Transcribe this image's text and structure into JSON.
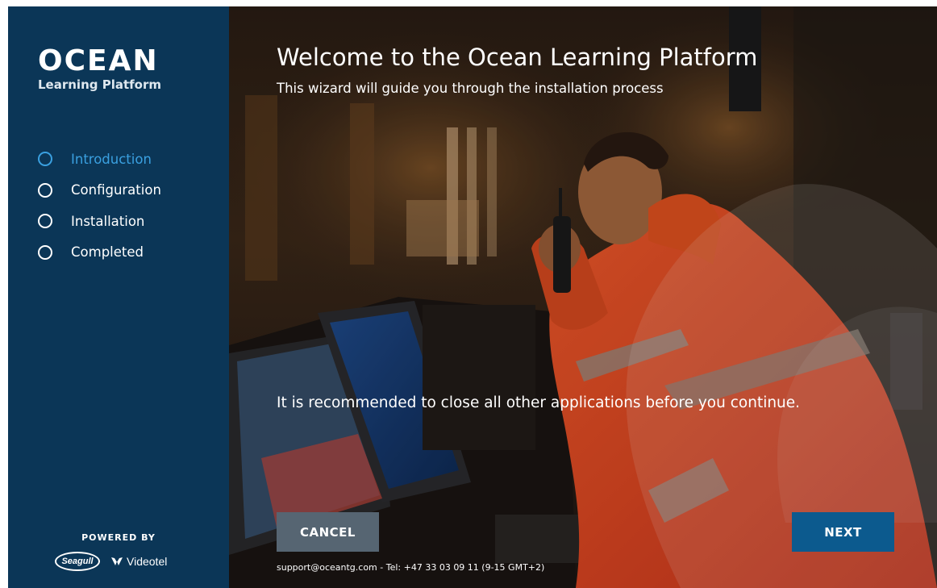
{
  "app": {
    "logo_main": "OCEAN",
    "logo_sub": "Learning Platform"
  },
  "sidebar": {
    "steps": [
      {
        "label": "Introduction",
        "active": true
      },
      {
        "label": "Configuration",
        "active": false
      },
      {
        "label": "Installation",
        "active": false
      },
      {
        "label": "Completed",
        "active": false
      }
    ],
    "powered_by": "POWERED BY",
    "partner_1": "Seagull",
    "partner_2": "Videotel"
  },
  "main": {
    "title": "Welcome to the Ocean Learning Platform",
    "subtitle": "This wizard will guide you through the installation process",
    "notice": "It is recommended to close all other applications before you continue.",
    "cancel_label": "CANCEL",
    "next_label": "NEXT",
    "support": "support@oceantg.com - Tel: +47 33 03 09 11 (9-15 GMT+2)"
  },
  "colors": {
    "sidebar_bg": "#0b3657",
    "active_step": "#3aa0e0",
    "cancel_button": "#566572",
    "next_button": "#0c5a8e"
  }
}
